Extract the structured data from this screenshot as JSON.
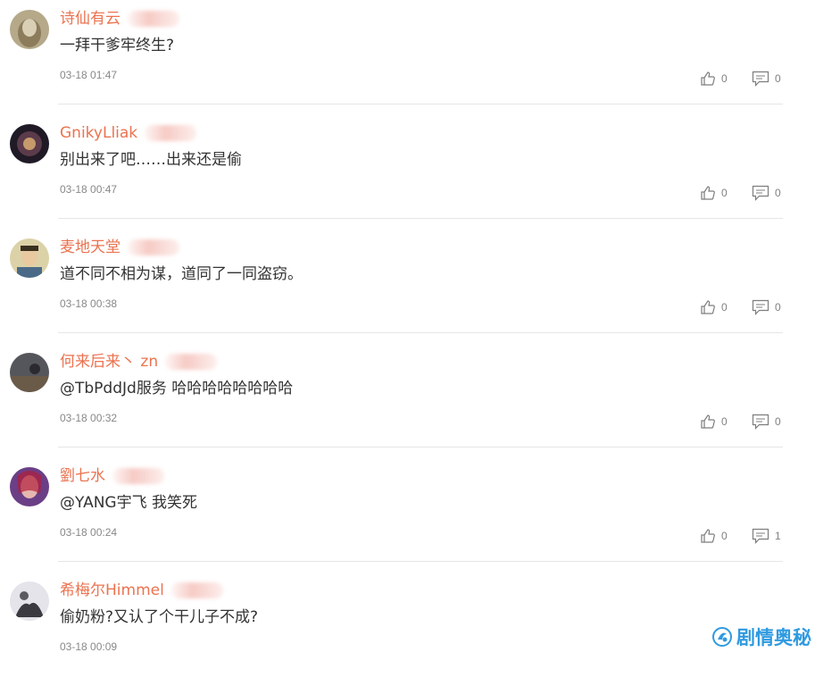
{
  "comments": [
    {
      "username": "诗仙有云",
      "text": "一拜干爹牢终生?",
      "time": "03-18 01:47",
      "likes": "0",
      "replies": "0",
      "avatar_color": "#9a8b6e"
    },
    {
      "username": "GnikyLliak",
      "text": "别出来了吧……出来还是偷",
      "time": "03-18 00:47",
      "likes": "0",
      "replies": "0",
      "avatar_color": "#3a3040"
    },
    {
      "username": "麦地天堂",
      "text": "道不同不相为谋，道同了一同盗窃。",
      "time": "03-18 00:38",
      "likes": "0",
      "replies": "0",
      "avatar_color": "#c7b98a"
    },
    {
      "username": "何来后来丶 zn",
      "text": "@TbPddJd服务 哈哈哈哈哈哈哈哈",
      "time": "03-18 00:32",
      "likes": "0",
      "replies": "0",
      "avatar_color": "#4a4a52"
    },
    {
      "username": "劉七水",
      "text": "@YANG宇飞 我笑死",
      "time": "03-18 00:24",
      "likes": "0",
      "replies": "1",
      "avatar_color": "#7a4f8a"
    },
    {
      "username": "希梅尔Himmel",
      "text": "偷奶粉?又认了个干儿子不成?",
      "time": "03-18 00:09",
      "likes": "",
      "replies": "",
      "avatar_color": "#d8d8e0"
    }
  ],
  "icons": {
    "like": "thumbs-up-icon",
    "reply": "comment-icon"
  },
  "watermark": {
    "text": "剧情奥秘",
    "color": "#2f9ae0"
  },
  "colors": {
    "username": "#eb7350",
    "text": "#333333",
    "time": "#888888"
  }
}
